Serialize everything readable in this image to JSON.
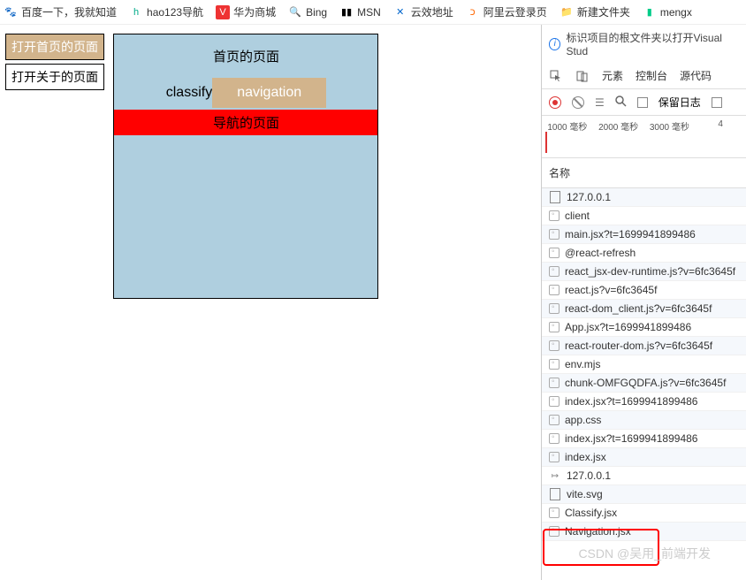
{
  "bookmarks": [
    {
      "icon": "🐾",
      "iconColor": "#e33",
      "label": "百度一下，我就知道"
    },
    {
      "icon": "h",
      "iconColor": "#0a8",
      "label": "hao123导航"
    },
    {
      "icon": "V",
      "iconColor": "#fff",
      "iconBg": "#e33",
      "label": "华为商城"
    },
    {
      "icon": "🔍",
      "iconColor": "#1a8",
      "label": "Bing"
    },
    {
      "icon": "▮▮",
      "iconColor": "#000",
      "label": "MSN"
    },
    {
      "icon": "✕",
      "iconColor": "#06c",
      "label": "云效地址"
    },
    {
      "icon": "כ",
      "iconColor": "#f60",
      "label": "阿里云登录页"
    },
    {
      "icon": "📁",
      "iconColor": "#fa3",
      "label": "新建文件夹"
    },
    {
      "icon": "▮",
      "iconColor": "#0c8",
      "label": "mengx"
    }
  ],
  "page": {
    "buttons": [
      {
        "label": "打开首页的页面",
        "active": true
      },
      {
        "label": "打开关于的页面",
        "active": false
      }
    ],
    "content": {
      "title": "首页的页面",
      "classify_label": "classify",
      "nav_badge": "navigation",
      "red_bar": "导航的页面"
    }
  },
  "devtools": {
    "info_text": "标识项目的根文件夹以打开Visual Stud",
    "tabs": [
      "元素",
      "控制台",
      "源代码"
    ],
    "preserve_log": "保留日志",
    "timeline": [
      "1000 毫秒",
      "2000 毫秒",
      "3000 毫秒",
      "4"
    ],
    "name_header": "名称",
    "requests": [
      {
        "type": "doc",
        "name": "127.0.0.1"
      },
      {
        "type": "js",
        "name": "client"
      },
      {
        "type": "js",
        "name": "main.jsx?t=1699941899486"
      },
      {
        "type": "js",
        "name": "@react-refresh"
      },
      {
        "type": "js",
        "name": "react_jsx-dev-runtime.js?v=6fc3645f"
      },
      {
        "type": "js",
        "name": "react.js?v=6fc3645f"
      },
      {
        "type": "js",
        "name": "react-dom_client.js?v=6fc3645f"
      },
      {
        "type": "js",
        "name": "App.jsx?t=1699941899486"
      },
      {
        "type": "js",
        "name": "react-router-dom.js?v=6fc3645f"
      },
      {
        "type": "js",
        "name": "env.mjs"
      },
      {
        "type": "js",
        "name": "chunk-OMFGQDFA.js?v=6fc3645f"
      },
      {
        "type": "js",
        "name": "index.jsx?t=1699941899486"
      },
      {
        "type": "js",
        "name": "app.css"
      },
      {
        "type": "js",
        "name": "index.jsx?t=1699941899486"
      },
      {
        "type": "js",
        "name": "index.jsx"
      },
      {
        "type": "fetch",
        "name": "127.0.0.1"
      },
      {
        "type": "doc",
        "name": "vite.svg"
      },
      {
        "type": "js",
        "name": "Classify.jsx"
      },
      {
        "type": "js",
        "name": "Navigation.jsx"
      }
    ]
  },
  "watermark": "CSDN @吴用_前端开发"
}
